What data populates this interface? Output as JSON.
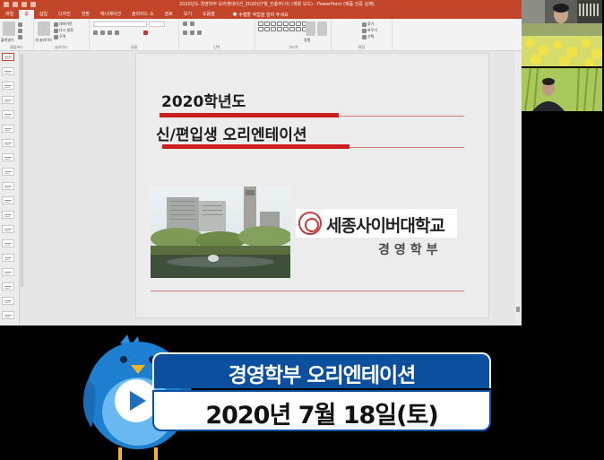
{
  "window": {
    "title": "2020년도 경영학부 오리엔테이션_2020년7월_진흥부(사) (재활 모드) - PowerPoint (제품 인증 실패)"
  },
  "ribbon_tabs": [
    "파일",
    "홈",
    "삽입",
    "디자인",
    "전환",
    "애니메이션",
    "슬라이드 쇼",
    "검토",
    "보기",
    "도움말"
  ],
  "tell_me": "수행할 작업을 알려 주세요",
  "ribbon_groups": {
    "clipboard": "클립보드",
    "slides": "슬라이드",
    "font": "글꼴",
    "paragraph": "단락",
    "drawing": "그리기",
    "editing": "편집"
  },
  "ribbon_buttons": {
    "paste": "붙여넣기",
    "new_slide": "새 슬라이드",
    "layout": "레이아웃",
    "reset": "다시 설정",
    "section": "구역",
    "find": "찾기",
    "replace": "바꾸기",
    "select": "선택",
    "arrange": "정렬",
    "quick_styles": "빠른 스타일"
  },
  "slide": {
    "title_line1": "2020학년도",
    "title_line2": "신/편입생 오리엔테이션",
    "university": "세종사이버대학교",
    "department": "경영학부"
  },
  "banner": {
    "title": "경영학부 오리엔테이션",
    "date": "2020년 7월 18일(토)",
    "mascot": "bluebird-mascot",
    "play_icon": "play-icon"
  },
  "colors": {
    "ppt_accent": "#c2452a",
    "banner_blue": "#0b4f9e",
    "mascot_blue": "#1e7ed0",
    "slide_red": "#cc1e1e"
  }
}
